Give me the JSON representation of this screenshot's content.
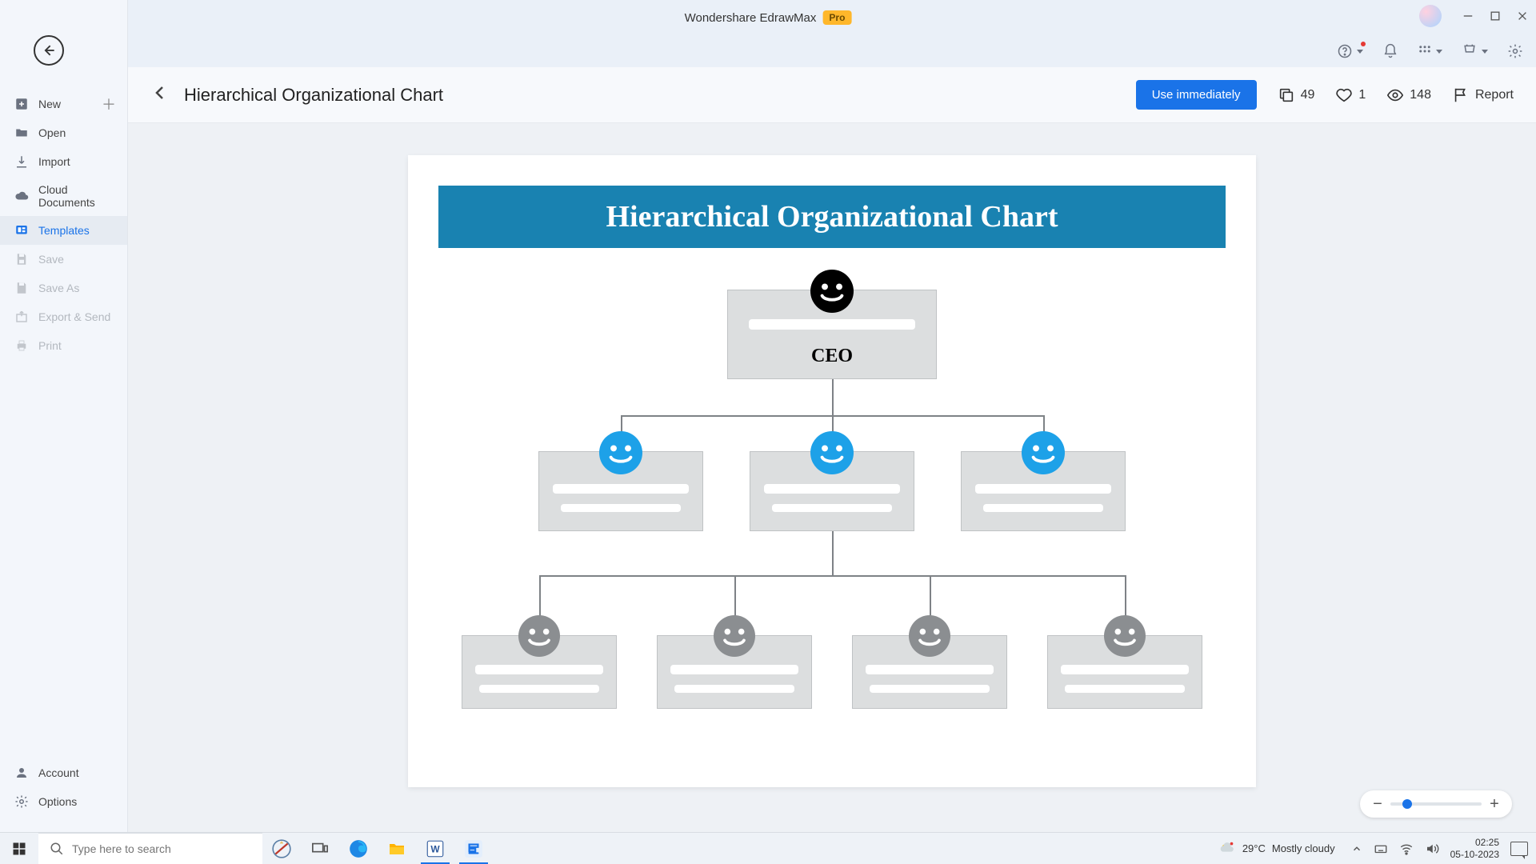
{
  "app": {
    "title": "Wondershare EdrawMax",
    "badge": "Pro"
  },
  "sidebar": {
    "items": [
      {
        "label": "New",
        "icon": "plus-square",
        "plus": true
      },
      {
        "label": "Open",
        "icon": "folder-open"
      },
      {
        "label": "Import",
        "icon": "import"
      },
      {
        "label": "Cloud Documents",
        "icon": "cloud"
      },
      {
        "label": "Templates",
        "icon": "templates",
        "active": true
      },
      {
        "label": "Save",
        "icon": "save",
        "disabled": true
      },
      {
        "label": "Save As",
        "icon": "save-as",
        "disabled": true
      },
      {
        "label": "Export & Send",
        "icon": "export",
        "disabled": true
      },
      {
        "label": "Print",
        "icon": "print",
        "disabled": true
      }
    ],
    "bottom": [
      {
        "label": "Account",
        "icon": "user"
      },
      {
        "label": "Options",
        "icon": "gear"
      }
    ]
  },
  "header": {
    "title": "Hierarchical Organizational Chart",
    "use_btn": "Use immediately",
    "copies": "49",
    "likes": "1",
    "views": "148",
    "report": "Report"
  },
  "template": {
    "banner": "Hierarchical Organizational Chart",
    "ceo_label": "CEO"
  },
  "taskbar": {
    "search_placeholder": "Type here to search",
    "weather_temp": "29°C",
    "weather_text": "Mostly cloudy",
    "time": "02:25",
    "date": "05-10-2023"
  }
}
